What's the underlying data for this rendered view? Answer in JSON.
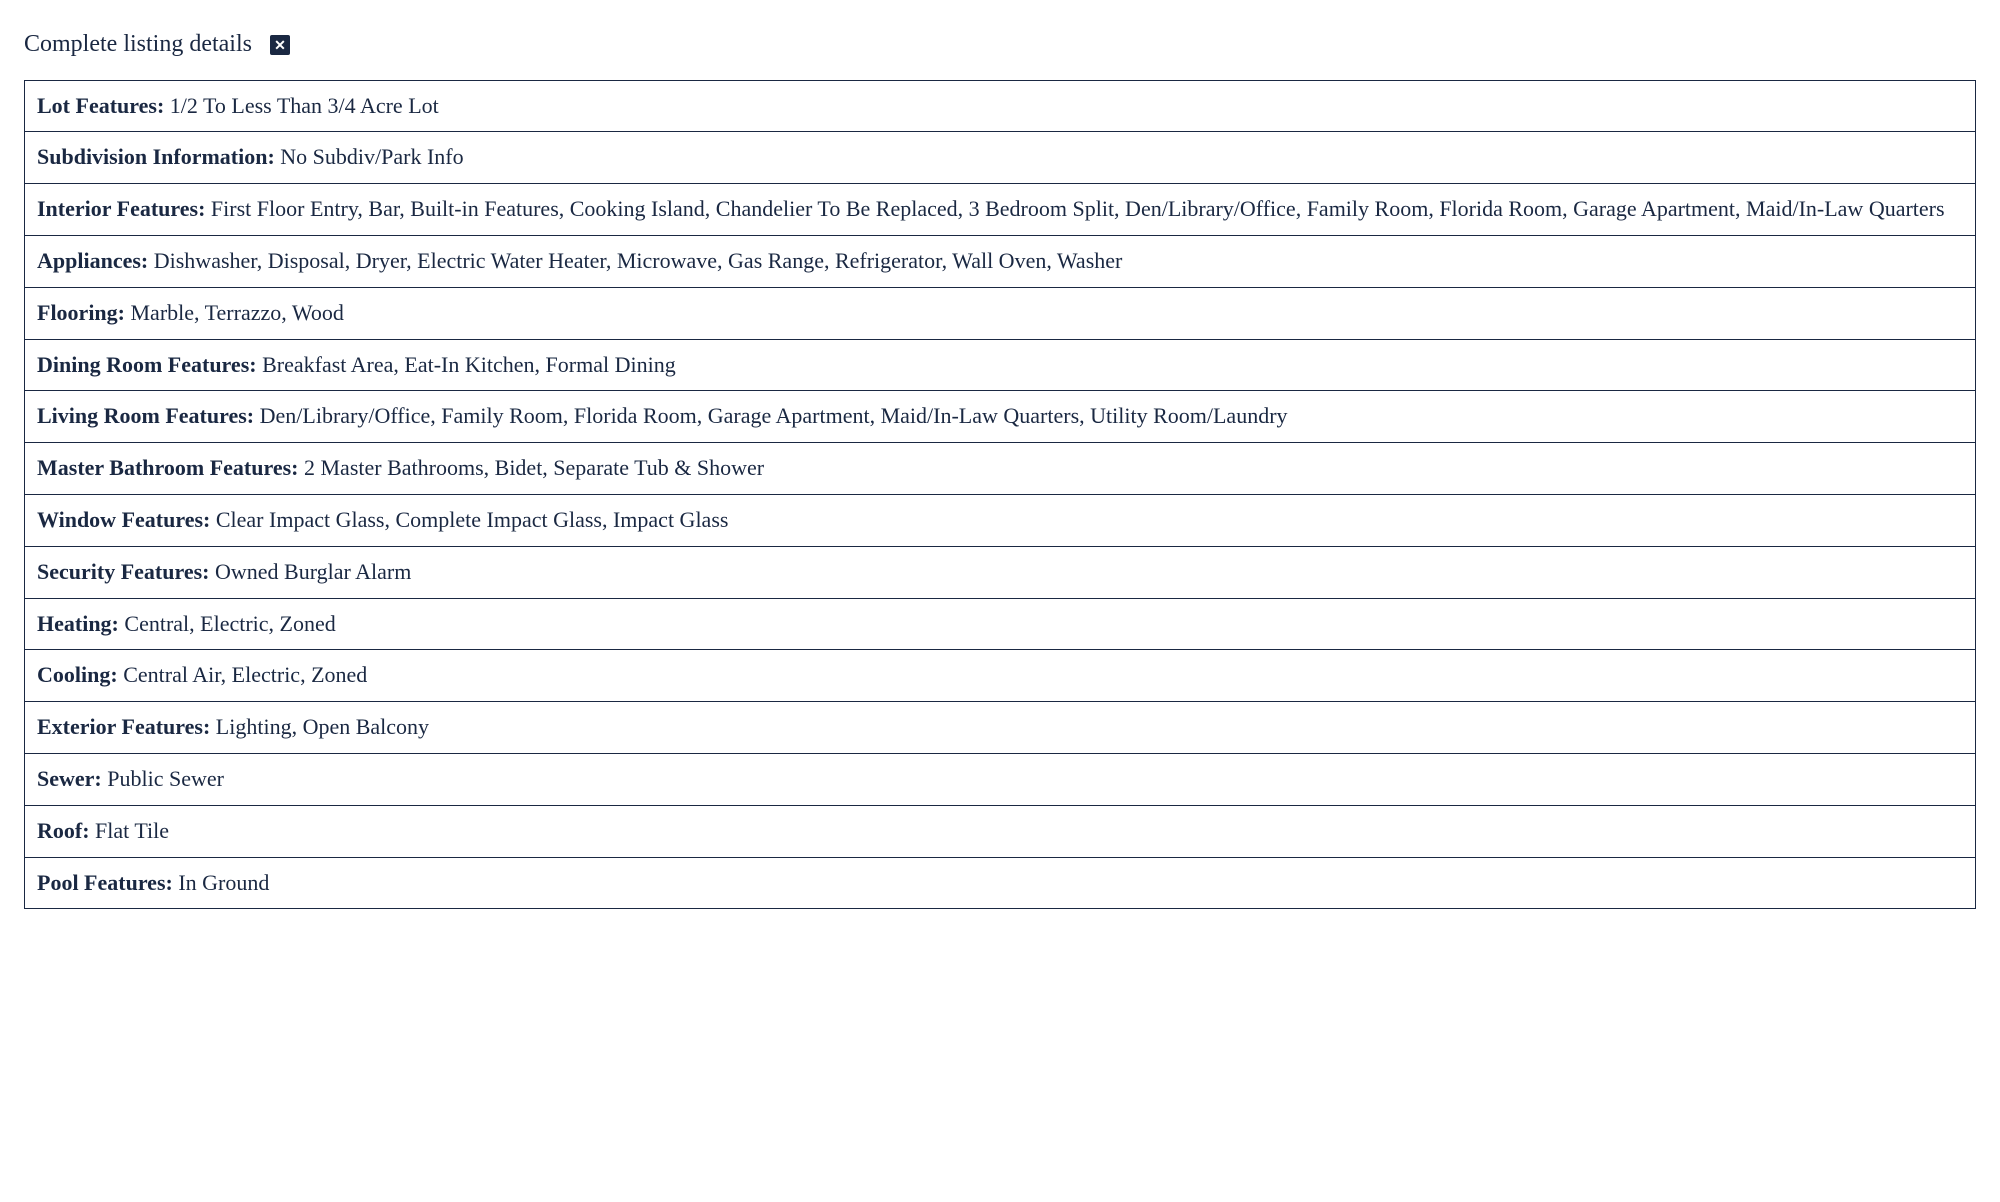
{
  "header": {
    "title": "Complete listing details"
  },
  "rows": [
    {
      "label": "Lot Features:",
      "value": " 1/2 To Less Than 3/4 Acre Lot"
    },
    {
      "label": "Subdivision Information:",
      "value": " No Subdiv/Park Info"
    },
    {
      "label": "Interior Features:",
      "value": " First Floor Entry, Bar, Built-in Features, Cooking Island, Chandelier To Be Replaced, 3 Bedroom Split, Den/Library/Office, Family Room, Florida Room, Garage Apartment, Maid/In-Law Quarters"
    },
    {
      "label": "Appliances:",
      "value": " Dishwasher, Disposal, Dryer, Electric Water Heater, Microwave, Gas Range, Refrigerator, Wall Oven, Washer"
    },
    {
      "label": "Flooring:",
      "value": " Marble, Terrazzo, Wood"
    },
    {
      "label": "Dining Room Features:",
      "value": " Breakfast Area, Eat-In Kitchen, Formal Dining"
    },
    {
      "label": "Living Room Features:",
      "value": " Den/Library/Office, Family Room, Florida Room, Garage Apartment, Maid/In-Law Quarters, Utility Room/Laundry"
    },
    {
      "label": "Master Bathroom Features:",
      "value": " 2 Master Bathrooms, Bidet, Separate Tub & Shower"
    },
    {
      "label": "Window Features:",
      "value": " Clear Impact Glass, Complete Impact Glass, Impact Glass"
    },
    {
      "label": "Security Features:",
      "value": " Owned Burglar Alarm"
    },
    {
      "label": "Heating:",
      "value": " Central, Electric, Zoned"
    },
    {
      "label": "Cooling:",
      "value": " Central Air, Electric, Zoned"
    },
    {
      "label": "Exterior Features:",
      "value": " Lighting, Open Balcony"
    },
    {
      "label": "Sewer:",
      "value": " Public Sewer"
    },
    {
      "label": "Roof:",
      "value": " Flat Tile"
    },
    {
      "label": "Pool Features:",
      "value": " In Ground"
    }
  ]
}
